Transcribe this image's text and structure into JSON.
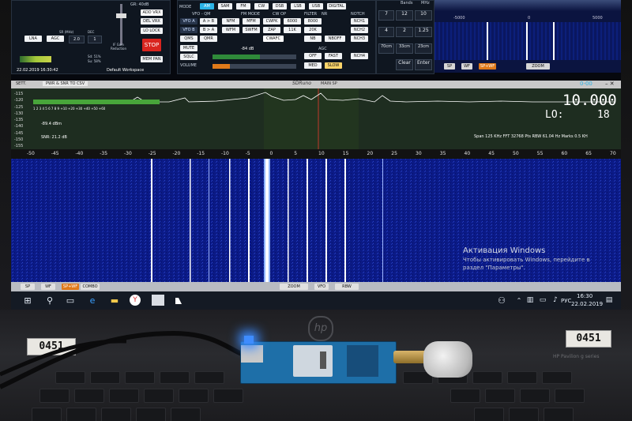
{
  "sdr": {
    "controls": {
      "gr_label": "GR: 40dB",
      "gain_label": "IF Gain\nReduction",
      "add_vrx": "ADD VRX",
      "del_vrx": "DEL VRX",
      "lo_lock": "LO LOCK",
      "stop": "STOP",
      "mem_pan": "MEM PAN",
      "lna": "LNA",
      "agc": "AGC",
      "sr_label": "SR (MHz)",
      "dec_label": "DEC",
      "sr_value": "2.0",
      "dec_value": "1",
      "sd": "Sd: 51%",
      "su": "Su: 58%",
      "datetime": "22.02.2019 16:30:42",
      "workspace": "Default Workspace",
      "mode_label": "MODE",
      "modes": [
        "AM",
        "SAM",
        "FM",
        "CW",
        "DSB",
        "LSB",
        "USB",
        "DIGITAL"
      ],
      "vfo_qm": "VFO - QM",
      "fm_mode": "FM MODE",
      "cw_op": "CW OP",
      "filter": "FILTER",
      "nr": "NR",
      "notch": "NOTCH",
      "row2": [
        "VFO A",
        "A > B",
        "NFM",
        "MFM",
        "CWPK",
        "6000",
        "8000",
        "NCH1"
      ],
      "row3": [
        "VFO B",
        "B > A",
        "WFM",
        "SWFM",
        "ZAP",
        "11K",
        "20K",
        "NCH2"
      ],
      "row4": [
        "QMS",
        "QMR",
        "",
        "",
        "CWAFC",
        "NB",
        "NBOFF",
        "NCH3"
      ],
      "mute": "MUTE",
      "sqlc": "SQLC",
      "volume": "VOLUME",
      "db": "-84 dB",
      "agc2": "AGC",
      "agc_btns": [
        "OFF",
        "FAST",
        "NCH4"
      ],
      "med": "MED",
      "slow": "SLOW",
      "keypad": [
        "1",
        "2",
        "3",
        "4",
        "5",
        "6",
        "7",
        "8",
        "9",
        "0"
      ],
      "bands": "Bands",
      "mhz": "MHz",
      "bandvals": [
        "12",
        "10",
        "6",
        "2",
        "1.25",
        "70cm",
        "33cm",
        "23cm"
      ],
      "clear": "Clear",
      "enter": "Enter",
      "mini_sp": "SP",
      "mini_wf": "WF",
      "mini_spwf": "SP+WF",
      "mini_zoom": "ZOOM",
      "mini_ticks": [
        "-5000",
        "0",
        "5000"
      ]
    },
    "spectrum": {
      "sett": "SETT.",
      "pwr_snr": "PWR & SNR TO CSV",
      "title": "SDRuno",
      "mainsp": "MAIN SP",
      "freq": "10.000",
      "freq_top": "0-00",
      "lo_label": "LO:",
      "lo_value": "18",
      "level": "-89.4 dBm",
      "snr": "SNR: 21.2 dB",
      "db_ticks": [
        "-115",
        "-120",
        "-125",
        "-130",
        "-135",
        "-140",
        "-145",
        "-150",
        "-155"
      ],
      "smeter_ticks": "1 2 3 4 5 6 7 8 9 +10 +20 +30 +40 +50 +60",
      "span": "Span 125 KHz   FFT 32768 Pts   RBW 61.04 Hz   Marks 0.5 KH",
      "scale": [
        "-50",
        "-45",
        "-40",
        "-35",
        "-30",
        "-25",
        "-20",
        "-15",
        "-10",
        "-5",
        "0",
        "5",
        "10",
        "15",
        "20",
        "25",
        "30",
        "35",
        "40",
        "45",
        "50",
        "55",
        "60",
        "65",
        "70"
      ]
    },
    "waterfall": {
      "activation_title": "Активация Windows",
      "activation_text1": "Чтобы активировать Windows, перейдите в",
      "activation_text2": "раздел \"Параметры\".",
      "sp": "SP",
      "wf": "WF",
      "spwf": "SP+WF",
      "combo": "COMBO",
      "zoom": "ZOOM",
      "vfo": "VFO",
      "rbw": "RBW"
    }
  },
  "taskbar": {
    "time": "16:30",
    "date": "22.02.2019",
    "lang": "РУС",
    "icons": [
      "windows-start",
      "search",
      "task-view",
      "edge",
      "explorer",
      "yandex",
      "sdruno"
    ]
  },
  "laptop": {
    "label_left": "0451",
    "label_right": "0451",
    "brand_mark": "hp",
    "model": "HP Pavilion g series"
  }
}
